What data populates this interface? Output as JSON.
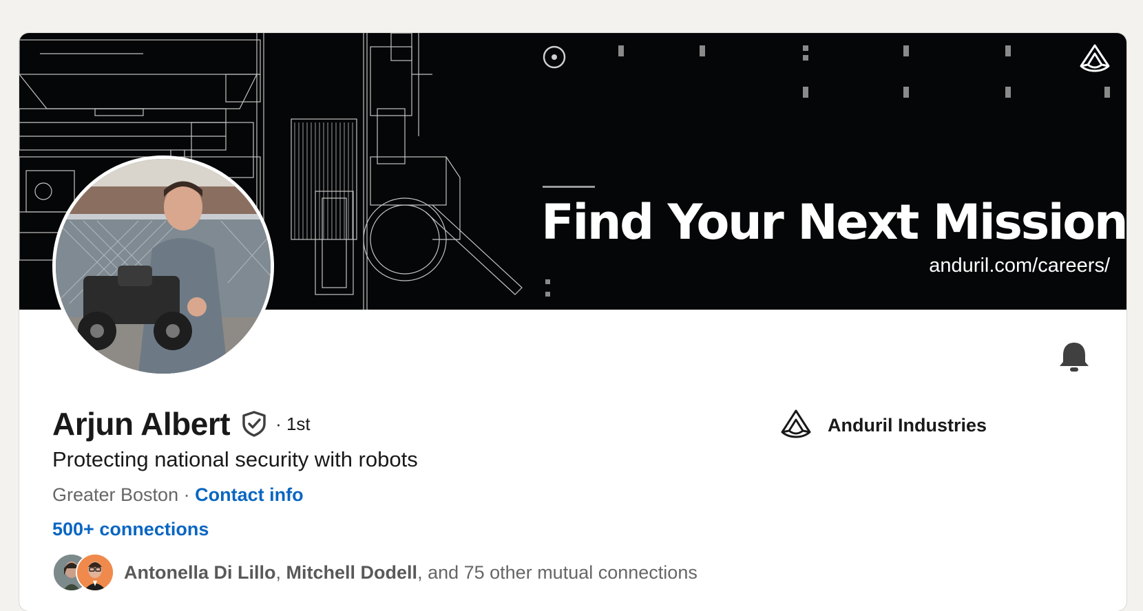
{
  "banner": {
    "headline": "Find Your Next Mission",
    "url": "anduril.com/careers/"
  },
  "profile": {
    "name": "Arjun Albert",
    "degree": "· 1st",
    "headline": "Protecting national security with robots",
    "location": "Greater Boston",
    "separator": " · ",
    "contact_label": "Contact info",
    "connections_label": "500+ connections"
  },
  "mutual": {
    "name1": "Antonella Di Lillo",
    "comma": ",",
    "name2": "Mitchell Dodell",
    "suffix": ", and 75 other mutual connections"
  },
  "company": {
    "name": "Anduril Industries"
  },
  "icons": {
    "banner_logo": "anduril-logo-icon",
    "verified": "shield-check-icon",
    "bell": "bell-icon",
    "company_logo": "anduril-logo-icon"
  },
  "colors": {
    "link": "#0a66c2",
    "banner_bg": "#050607",
    "page_bg": "#f4f2ee"
  }
}
